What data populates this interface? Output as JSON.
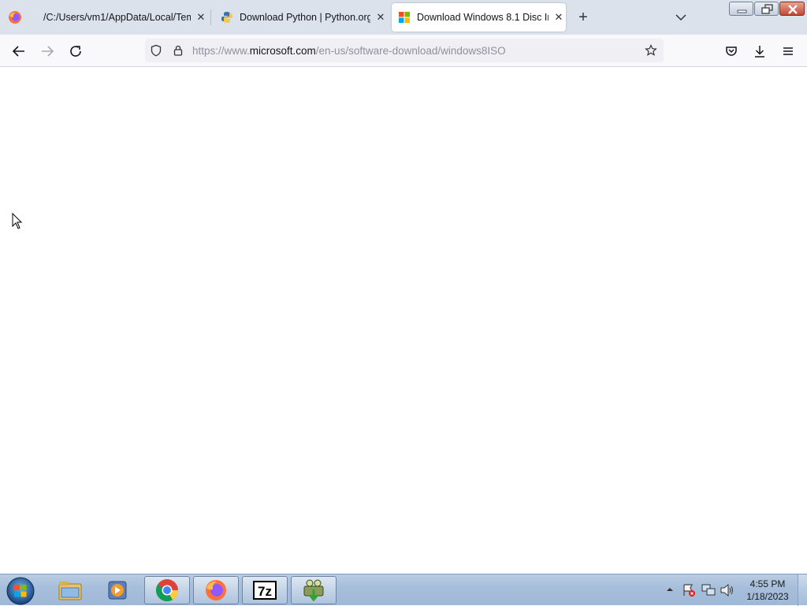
{
  "browser": {
    "tabs": [
      {
        "label": "/C:/Users/vm1/AppData/Local/Tem",
        "favicon": "none",
        "active": false
      },
      {
        "label": "Download Python | Python.org",
        "favicon": "python-logo-icon",
        "active": false
      },
      {
        "label": "Download Windows 8.1 Disc Im",
        "favicon": "microsoft-logo-icon",
        "active": true
      }
    ],
    "url": {
      "prefix": "https://www.",
      "host": "microsoft.com",
      "path": "/en-us/software-download/windows8ISO"
    }
  },
  "taskbar": {
    "apps": [
      "windows-explorer-icon",
      "media-player-icon",
      "chrome-icon",
      "firefox-icon",
      "7zip-icon",
      "python-installer-icon"
    ],
    "clock": {
      "time": "4:55 PM",
      "date": "1/18/2023"
    }
  },
  "colors": {
    "tabbar_bg": "#dbe2ec",
    "taskbar_bg": "#a7bfdb",
    "firefox_orange": "#ff7139"
  }
}
